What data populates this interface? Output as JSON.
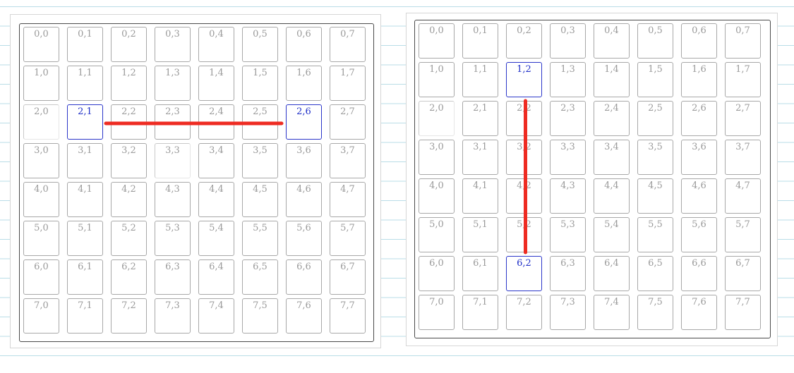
{
  "left_board": {
    "rows": 8,
    "cols": 8,
    "selected": [
      [
        2,
        1
      ],
      [
        2,
        6
      ]
    ],
    "dim_cells": [
      [
        2,
        0
      ],
      [
        3,
        3
      ]
    ],
    "connector": {
      "from": [
        2,
        1
      ],
      "to": [
        2,
        6
      ],
      "orientation": "horizontal"
    }
  },
  "right_board": {
    "rows": 8,
    "cols": 8,
    "selected": [
      [
        1,
        2
      ],
      [
        6,
        2
      ]
    ],
    "dim_cells": [
      [
        2,
        0
      ]
    ],
    "connector": {
      "from": [
        1,
        2
      ],
      "to": [
        6,
        2
      ],
      "orientation": "vertical"
    }
  },
  "cell_label_separator": ",",
  "colors": {
    "selected_border": "#2b36c9",
    "selected_text": "#2030c8",
    "label_text": "#9a9a9a",
    "cell_border": "#a8a8a8",
    "connector_line": "#ee2b22",
    "ruled_line": "#b9dde7"
  }
}
